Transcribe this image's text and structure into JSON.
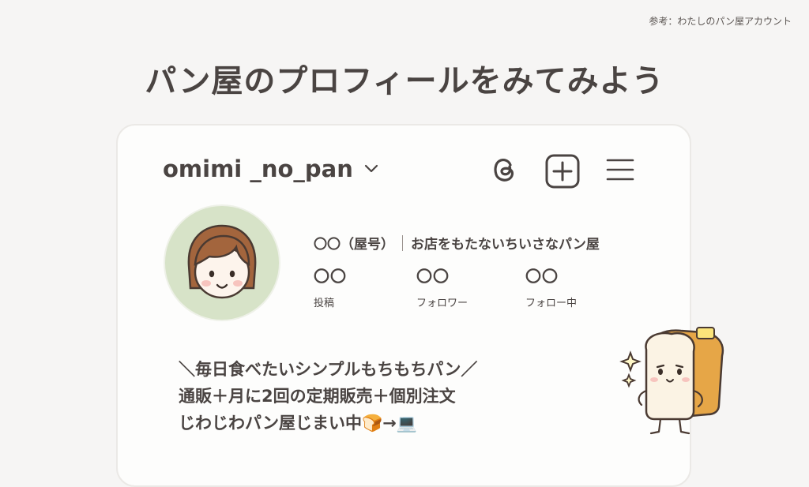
{
  "reference": "参考：わたしのパン屋アカウント",
  "headline": "パン屋のプロフィールをみてみよう",
  "profile": {
    "username": "omimi _no_pan",
    "name_part": "〇〇（屋号）",
    "tagline": "お店をもたないちいさなパン屋",
    "stats": [
      {
        "value": "〇〇",
        "label": "投稿"
      },
      {
        "value": "〇〇",
        "label": "フォロワー"
      },
      {
        "value": "〇〇",
        "label": "フォロー中"
      }
    ],
    "bio": [
      "＼毎日食べたいシンプルもちもちパン／",
      "通販＋月に2回の定期販売＋個別注文",
      "じわじわパン屋じまい中🍞→💻"
    ]
  },
  "icons": {
    "threads": "threads-icon",
    "create": "plus-square-icon",
    "menu": "menu-icon",
    "dropdown": "chevron-down-icon"
  },
  "colors": {
    "background": "#f6f5f4",
    "text": "#4a4442",
    "avatar_bg": "#d7e3c8"
  }
}
